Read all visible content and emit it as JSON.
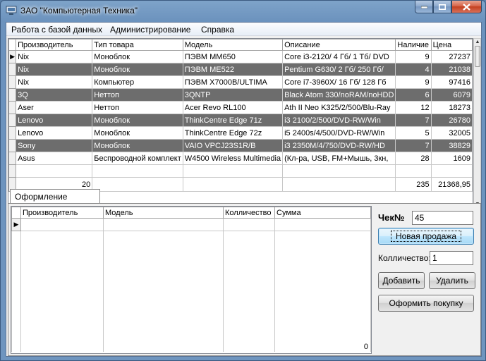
{
  "window": {
    "title": "ЗАО \"Компьютерная Техника\""
  },
  "menu": [
    "Работа с базой данных",
    "Администрирование",
    "Справка"
  ],
  "products": {
    "columns": [
      "Производитель",
      "Тип товара",
      "Модель",
      "Описание",
      "Наличие",
      "Цена"
    ],
    "rows": [
      [
        "Nix",
        "Моноблок",
        "ПЭВМ MM650",
        "Core i3-2120/ 4 Гб/ 1 Тб/ DVD",
        "9",
        "27237"
      ],
      [
        "Nix",
        "Моноблок",
        "ПЭВМ ME522",
        "Pentium G630/ 2 Гб/ 250 Гб/",
        "4",
        "21038"
      ],
      [
        "Nix",
        "Компьютер",
        "ПЭВМ X7000B/ULTIMA",
        "Core i7-3960X/ 16 Гб/ 128 Гб",
        "9",
        "97416"
      ],
      [
        "3Q",
        "Неттоп",
        "3QNTP",
        " Black Atom 330/noRAM/noHDD",
        "6",
        "6079"
      ],
      [
        "Aser",
        "Неттоп",
        "Acer Revo RL100",
        "Ath II Neo K325/2/500/Blu-Ray",
        "12",
        "18273"
      ],
      [
        "Lenovo",
        "Моноблок",
        "ThinkCentre Edge 71z",
        "i3 2100/2/500/DVD-RW/Win",
        "7",
        "26780"
      ],
      [
        "Lenovo",
        "Моноблок",
        "ThinkCentre Edge 72z",
        "i5 2400s/4/500/DVD-RW/Win",
        "5",
        "32005"
      ],
      [
        "Sony",
        "Моноблок",
        "VAIO VPCJ23S1R/B",
        "i3 2350M/4/750/DVD-RW/HD",
        "7",
        "38829"
      ],
      [
        "Asus",
        "Беспроводной комплект",
        "W4500 Wireless Multimedia",
        "(Кл-ра, USB, FM+Мышь, 3кн,",
        "28",
        "1609"
      ]
    ],
    "totals": {
      "count": "20",
      "stock": "235",
      "price": "21368,95"
    }
  },
  "tab": {
    "label": "Оформление продажи"
  },
  "sale": {
    "columns": [
      "Производитель",
      "Модель",
      "Колличество",
      "Сумма"
    ],
    "total": "0"
  },
  "form": {
    "check_label": "Чек№",
    "check_value": "45",
    "new_sale": "Новая продажа",
    "qty_label": "Колличество:",
    "qty_value": "1",
    "add": "Добавить",
    "remove": "Удалить",
    "checkout": "Оформить покупку"
  }
}
